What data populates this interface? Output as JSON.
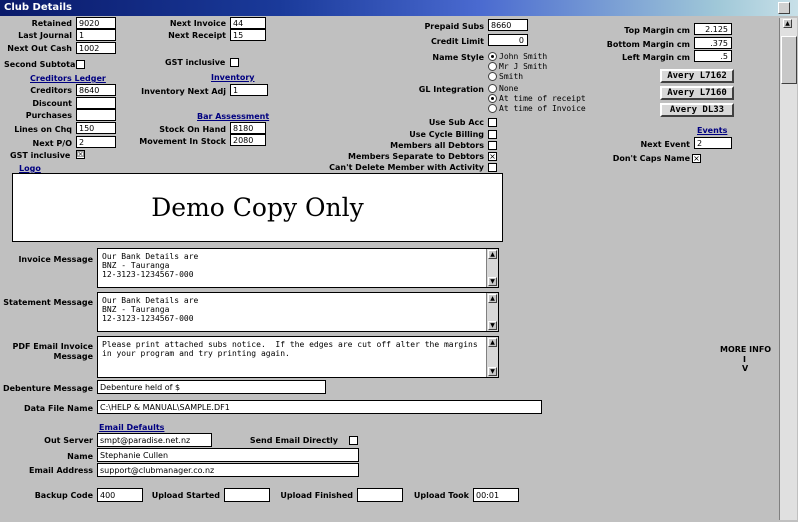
{
  "window": {
    "title": "Club Details"
  },
  "left": {
    "retained_label": "Retained",
    "retained": "9020",
    "last_journal_label": "Last Journal",
    "last_journal": "1",
    "next_out_cash_label": "Next Out Cash",
    "next_out_cash": "1002",
    "second_subtotal_label": "Second Subtotal",
    "creditors_ledger_header": "Creditors Ledger",
    "creditors_label": "Creditors",
    "creditors": "8640",
    "discount_label": "Discount",
    "discount": "",
    "purchases_label": "Purchases",
    "purchases": "",
    "lines_on_chq_label": "Lines on Chq",
    "lines_on_chq": "150",
    "next_po_label": "Next P/O",
    "next_po": "2",
    "gst_inclusive_label": "GST inclusive",
    "gst_inclusive_checked": "☒",
    "logo_header": "Logo"
  },
  "middle": {
    "next_invoice_label": "Next Invoice",
    "next_invoice": "44",
    "next_receipt_label": "Next Receipt",
    "next_receipt": "15",
    "gst_inclusive_label": "GST inclusive",
    "inventory_header": "Inventory",
    "inventory_next_adj_label": "Inventory Next Adj",
    "inventory_next_adj": "1",
    "bar_assessment_header": "Bar Assessment",
    "stock_on_hand_label": "Stock On Hand",
    "stock_on_hand": "8180",
    "movement_in_stock_label": "Movement In Stock",
    "movement_in_stock": "2080"
  },
  "center": {
    "prepaid_subs_label": "Prepaid Subs",
    "prepaid_subs": "8660",
    "credit_limit_label": "Credit Limit",
    "credit_limit": "0",
    "name_style_label": "Name Style",
    "name_style_options": [
      "John Smith",
      "Mr J Smith",
      "Smith"
    ],
    "gl_integration_label": "GL Integration",
    "gl_options": [
      "None",
      "At time of receipt",
      "At time of Invoice"
    ],
    "use_sub_acc_label": "Use Sub Acc",
    "use_cycle_billing_label": "Use Cycle Billing",
    "members_all_debtors_label": "Members all Debtors",
    "members_separate_label": "Members Separate to Debtors",
    "members_separate_mark": "×",
    "cant_delete_label": "Can't Delete Member with Activity"
  },
  "right": {
    "top_margin_label": "Top Margin cm",
    "top_margin": "2.125",
    "bottom_margin_label": "Bottom Margin cm",
    "bottom_margin": ".375",
    "left_margin_label": "Left Margin cm",
    "left_margin": ".5",
    "avery1": "Avery L7162",
    "avery2": "Avery L7160",
    "avery3": "Avery DL33",
    "events_header": "Events",
    "next_event_label": "Next Event",
    "next_event": "2",
    "dont_caps_label": "Don't Caps Name",
    "dont_caps_mark": "×"
  },
  "logo": {
    "text": "Demo Copy Only"
  },
  "messages": {
    "invoice_label": "Invoice Message",
    "invoice_text": "Our Bank Details are\nBNZ - Tauranga\n12-3123-1234567-000",
    "statement_label": "Statement Message",
    "statement_text": "Our Bank Details are\nBNZ - Tauranga\n12-3123-1234567-000",
    "pdf_label_1": "PDF Email Invoice",
    "pdf_label_2": "Message",
    "pdf_text": "Please print attached subs notice.  If the edges are cut off alter the margins\nin your program and try printing again.",
    "debenture_label": "Debenture Message",
    "debenture": "Debenture held of $",
    "data_file_label": "Data File Name",
    "data_file": "C:\\HELP & MANUAL\\SAMPLE.DF1"
  },
  "more_info": {
    "line1": "MORE INFO",
    "line2": "I",
    "line3": "V"
  },
  "email": {
    "header": "Email Defaults",
    "out_server_label": "Out Server",
    "out_server": "smpt@paradise.net.nz",
    "send_directly_label": "Send Email Directly",
    "name_label": "Name",
    "name": "Stephanie Cullen",
    "address_label": "Email Address",
    "address": "support@clubmanager.co.nz"
  },
  "bottom": {
    "backup_code_label": "Backup Code",
    "backup_code": "400",
    "upload_started_label": "Upload Started",
    "upload_started": "",
    "upload_finished_label": "Upload Finished",
    "upload_finished": "",
    "upload_took_label": "Upload Took",
    "upload_took": "00:01"
  }
}
